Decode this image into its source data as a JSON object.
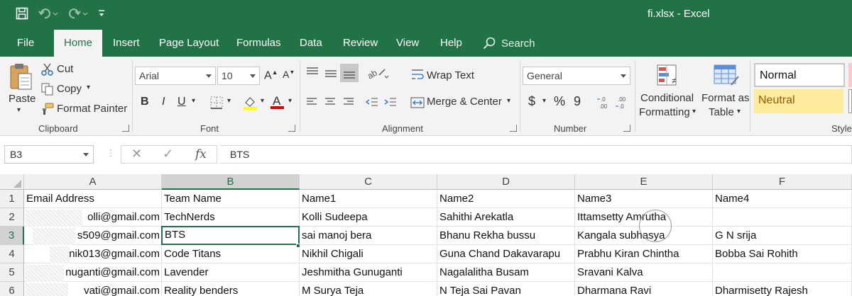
{
  "window": {
    "title": "fi.xlsx  -  Excel"
  },
  "tabs": [
    "File",
    "Home",
    "Insert",
    "Page Layout",
    "Formulas",
    "Data",
    "Review",
    "View",
    "Help"
  ],
  "search": {
    "label": "Search"
  },
  "ribbon": {
    "clipboard": {
      "paste": "Paste",
      "cut": "Cut",
      "copy": "Copy",
      "format_painter": "Format Painter",
      "label": "Clipboard"
    },
    "font": {
      "name": "Arial",
      "size": "10",
      "bold": "B",
      "italic": "I",
      "underline": "U",
      "label": "Font",
      "font_color": "#e00000",
      "highlight_color": "#ffff00"
    },
    "alignment": {
      "wrap_text": "Wrap Text",
      "merge_center": "Merge & Center",
      "label": "Alignment"
    },
    "number": {
      "format": "General",
      "currency": "$",
      "percent": "%",
      "comma": "9",
      "label": "Number"
    },
    "styles": {
      "conditional_1": "Conditional",
      "conditional_2": "Formatting",
      "format_as_1": "Format as",
      "format_as_2": "Table",
      "normal": "Normal",
      "neutral": "Neutral",
      "label": "Style"
    }
  },
  "formula_bar": {
    "name_box": "B3",
    "fx": "fx",
    "value": "BTS"
  },
  "columns": [
    "A",
    "B",
    "C",
    "D",
    "E",
    "F"
  ],
  "rows": [
    "1",
    "2",
    "3",
    "4",
    "5",
    "6"
  ],
  "cells": [
    [
      "Email Address",
      "Team Name",
      "Name1",
      "Name2",
      "Name3",
      "Name4"
    ],
    [
      "olli@gmail.com",
      "TechNerds",
      "Kolli Sudeepa",
      "Sahithi Arekatla",
      "Ittamsetty Amrutha",
      ""
    ],
    [
      "s509@gmail.com",
      "BTS",
      "sai manoj bera",
      "Bhanu Rekha bussu",
      "Kangala subhasya",
      "G N srija"
    ],
    [
      "nik013@gmail.com",
      "Code Titans",
      "Nikhil Chigali",
      "Guna Chand Dakavarapu",
      "Prabhu Kiran Chintha",
      "Bobba Sai Rohith"
    ],
    [
      "nuganti@gmail.com",
      "Lavender",
      "Jeshmitha Gunuganti",
      "Nagalalitha Busam",
      "Sravani Kalva",
      ""
    ],
    [
      "vati@gmail.com",
      "Reality benders",
      "M Surya Teja",
      "N Teja Sai Pavan",
      "Dharmana Ravi",
      "Dharmisetty Rajesh"
    ]
  ],
  "selected_cell": "B3",
  "colors": {
    "brand": "#217346",
    "neutral_style": "#ffeb9c",
    "neutral_text": "#9c5700"
  }
}
